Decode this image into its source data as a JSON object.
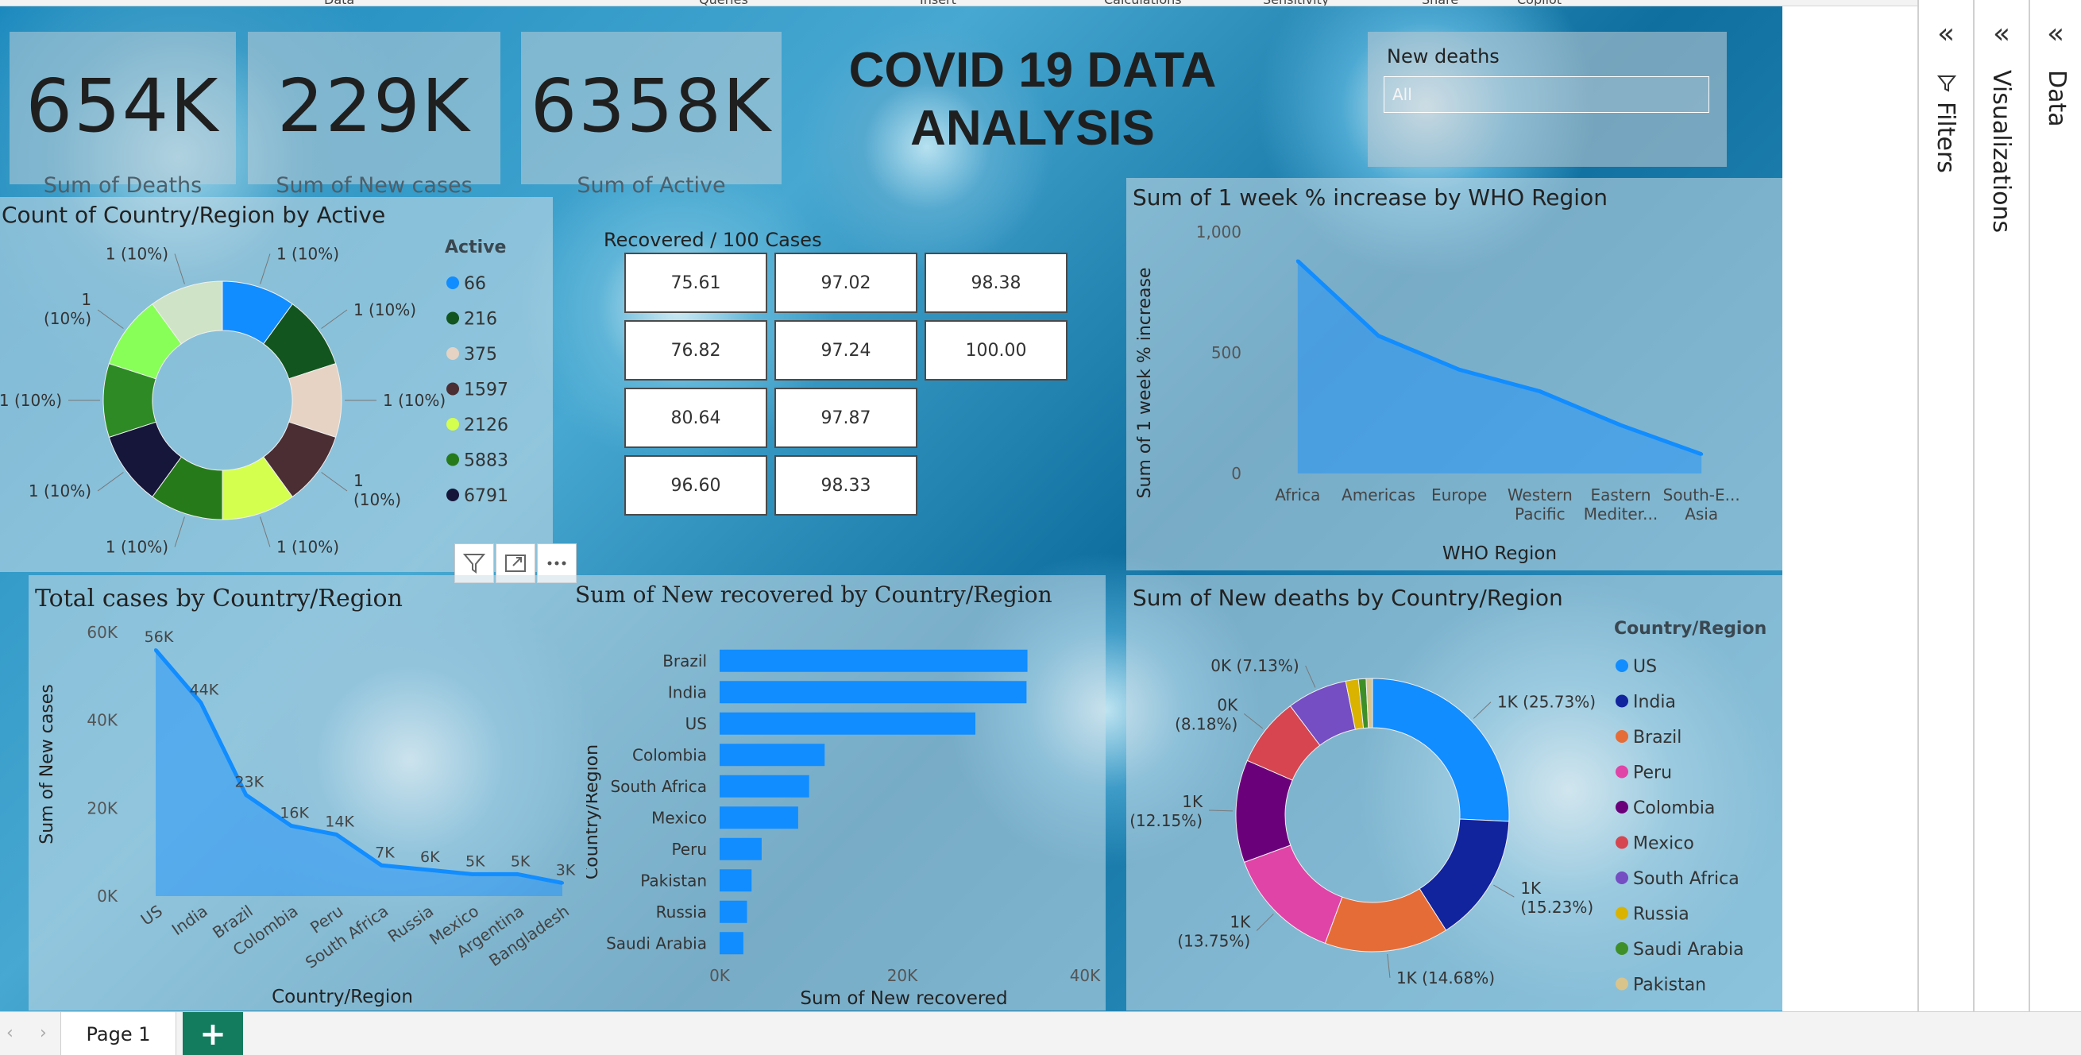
{
  "ribbon": {
    "tabs": [
      "Data",
      "Queries",
      "Insert",
      "Calculations",
      "Sensitivity",
      "Share",
      "Copilot"
    ]
  },
  "kpis": [
    {
      "value": "654K",
      "label": "Sum of Deaths"
    },
    {
      "value": "229K",
      "label": "Sum of New cases"
    },
    {
      "value": "6358K",
      "label": "Sum of Active"
    }
  ],
  "title": {
    "line1": "COVID 19 DATA",
    "line2": "ANALYSIS"
  },
  "slicer": {
    "label": "New deaths",
    "value": "All"
  },
  "donut_active": {
    "title": "Count of Country/Region by Active",
    "legend_title": "Active",
    "slice_label": "1 (10%)",
    "slice_label_wrapped": [
      "1",
      "(10%)"
    ],
    "legend": [
      {
        "label": "66",
        "color": "#118dff"
      },
      {
        "label": "216",
        "color": "#12551f"
      },
      {
        "label": "375",
        "color": "#e6d3c3"
      },
      {
        "label": "1597",
        "color": "#4a2e33"
      },
      {
        "label": "2126",
        "color": "#d4ff4f"
      },
      {
        "label": "5883",
        "color": "#267a1a"
      },
      {
        "label": "6791",
        "color": "#16163a"
      }
    ]
  },
  "recovered_table": {
    "title": "Recovered / 100 Cases",
    "columns": [
      [
        "75.61",
        "76.82",
        "80.64",
        "96.60"
      ],
      [
        "97.02",
        "97.24",
        "97.87",
        "98.33"
      ],
      [
        "98.38",
        "100.00"
      ]
    ]
  },
  "icons": {
    "filter": "filter-icon",
    "focus": "focus-mode-icon",
    "more": "more-options-icon"
  },
  "panes": {
    "filters": "Filters",
    "visualizations": "Visualizations",
    "data": "Data"
  },
  "tabs": {
    "page1": "Page 1",
    "add": "+"
  },
  "chart_data": [
    {
      "type": "area",
      "title": "Sum of 1 week % increase by WHO Region",
      "xlabel": "WHO Region",
      "ylabel": "Sum of 1 week % increase",
      "categories": [
        "Africa",
        "Americas",
        "Europe",
        "Western Pacific",
        "Eastern Mediter...",
        "South-E... Asia"
      ],
      "category_lines": [
        [
          "Africa"
        ],
        [
          "Americas"
        ],
        [
          "Europe"
        ],
        [
          "Western",
          "Pacific"
        ],
        [
          "Eastern",
          "Mediter..."
        ],
        [
          "South-E...",
          "Asia"
        ]
      ],
      "values": [
        880,
        570,
        430,
        340,
        200,
        80
      ],
      "yticks": [
        "0",
        "500",
        "1,000"
      ],
      "ylim": [
        0,
        1000
      ],
      "color": "#118dff"
    },
    {
      "type": "area",
      "title": "Total cases by Country/Region",
      "xlabel": "Country/Region",
      "ylabel": "Sum of New cases",
      "categories": [
        "US",
        "India",
        "Brazil",
        "Colombia",
        "Peru",
        "South Africa",
        "Russia",
        "Mexico",
        "Argentina",
        "Bangladesh"
      ],
      "values": [
        56,
        44,
        23,
        16,
        14,
        7,
        6,
        5,
        5,
        3
      ],
      "data_labels": [
        "56K",
        "44K",
        "23K",
        "16K",
        "14K",
        "7K",
        "6K",
        "5K",
        "5K",
        "3K"
      ],
      "yticks": [
        "0K",
        "20K",
        "40K",
        "60K"
      ],
      "ylim": [
        0,
        60
      ],
      "color": "#118dff"
    },
    {
      "type": "bar",
      "title": "Sum of New recovered by Country/Region",
      "xlabel": "Sum of New recovered",
      "ylabel": "Country/Region",
      "categories": [
        "Brazil",
        "India",
        "US",
        "Colombia",
        "South Africa",
        "Mexico",
        "Peru",
        "Pakistan",
        "Russia",
        "Saudi Arabia"
      ],
      "values": [
        33.7,
        33.6,
        28,
        11.5,
        9.8,
        8.6,
        4.6,
        3.5,
        3.0,
        2.6
      ],
      "xticks": [
        "0K",
        "20K",
        "40K"
      ],
      "xlim": [
        0,
        40
      ],
      "color": "#118dff"
    },
    {
      "type": "pie",
      "title": "Sum of New deaths by Country/Region",
      "legend_title": "Country/Region",
      "labels": [
        "US",
        "India",
        "Brazil",
        "Peru",
        "Colombia",
        "Mexico",
        "South Africa",
        "Russia",
        "Saudi Arabia",
        "Pakistan"
      ],
      "values": [
        25.73,
        15.23,
        14.68,
        13.75,
        12.15,
        8.18,
        7.13,
        1.5,
        0.9,
        0.75
      ],
      "colors": [
        "#118dff",
        "#12239e",
        "#e66c37",
        "#e044a7",
        "#6b007b",
        "#d64550",
        "#744ec2",
        "#d9b300",
        "#3f8f29",
        "#d9c48c"
      ],
      "slice_labels": [
        "1K (25.73%)",
        "1K (15.23%)",
        "1K (14.68%)",
        "1K (13.75%)",
        "1K (12.15%)",
        "0K (8.18%)",
        "0K (7.13%)"
      ],
      "slice_label_lines": [
        [
          "1K (25.73%)"
        ],
        [
          "1K",
          "(15.23%)"
        ],
        [
          "1K (14.68%)"
        ],
        [
          "1K",
          "(13.75%)"
        ],
        [
          "1K",
          "(12.15%)"
        ],
        [
          "0K",
          "(8.18%)"
        ],
        [
          "0K (7.13%)"
        ]
      ]
    }
  ]
}
